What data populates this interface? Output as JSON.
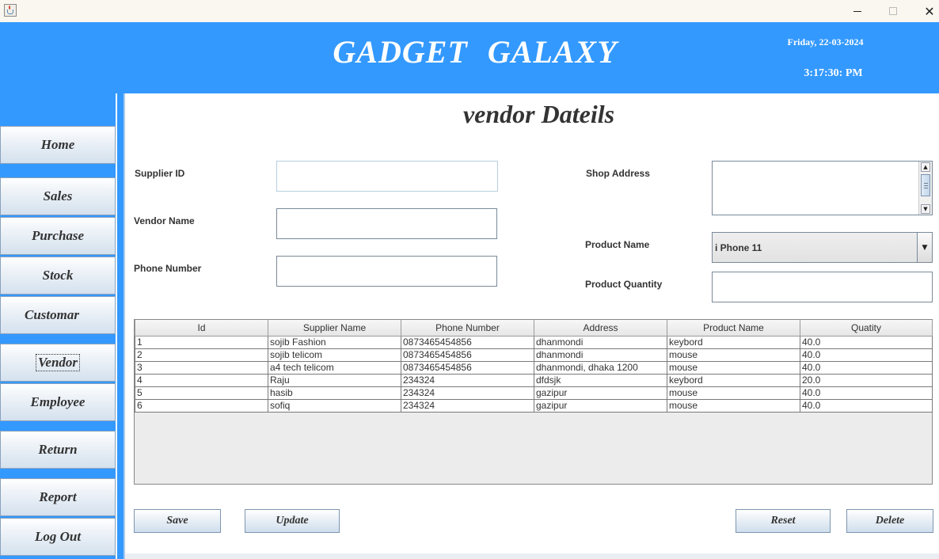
{
  "window": {
    "app_icon": "java-icon",
    "minimize_icon": "minimize-icon",
    "maximize_icon": "maximize-icon",
    "close_icon": "close-icon",
    "close_glyph": "✕"
  },
  "header": {
    "brand": "GADGET  GALAXY",
    "date": "Friday, 22-03-2024",
    "time": "3:17:30: PM",
    "bg_color": "#3399ff"
  },
  "sidebar": {
    "items": [
      {
        "label": "Home"
      },
      {
        "label": "Sales"
      },
      {
        "label": "Purchase"
      },
      {
        "label": "Stock"
      },
      {
        "label": "Customar"
      },
      {
        "label": "Vendor",
        "active": true
      },
      {
        "label": "Employee"
      },
      {
        "label": "Return"
      },
      {
        "label": "Report"
      },
      {
        "label": "Log Out"
      }
    ]
  },
  "form": {
    "title": "vendor Dateils",
    "supplier_id_label": "Supplier ID",
    "supplier_id_value": "",
    "vendor_name_label": "Vendor Name",
    "vendor_name_value": "",
    "phone_label": "Phone Number",
    "phone_value": "",
    "shop_address_label": "Shop Address",
    "shop_address_value": "",
    "product_name_label": "Product  Name",
    "product_name_selected": "i Phone 11",
    "product_qty_label": "Product  Quantity",
    "product_qty_value": ""
  },
  "table": {
    "columns": [
      "Id",
      "Supplier Name",
      "Phone Number",
      "Address",
      "Product Name",
      "Quatity"
    ],
    "rows": [
      [
        "1",
        "sojib Fashion",
        "0873465454856",
        "dhanmondi",
        "keybord",
        "40.0"
      ],
      [
        "2",
        "sojib telicom",
        "0873465454856",
        "dhanmondi",
        "mouse",
        "40.0"
      ],
      [
        "3",
        "a4 tech telicom",
        "0873465454856",
        "dhanmondi, dhaka 1200",
        "mouse",
        "40.0"
      ],
      [
        "4",
        "Raju",
        "234324",
        "dfdsjk",
        "keybord",
        "20.0"
      ],
      [
        "5",
        "hasib",
        "234324",
        "gazipur",
        "mouse",
        "40.0"
      ],
      [
        "6",
        "sofiq",
        "234324",
        "gazipur",
        "mouse",
        "40.0"
      ]
    ]
  },
  "actions": {
    "save": "Save",
    "update": "Update",
    "reset": "Reset",
    "delete": "Delete"
  }
}
